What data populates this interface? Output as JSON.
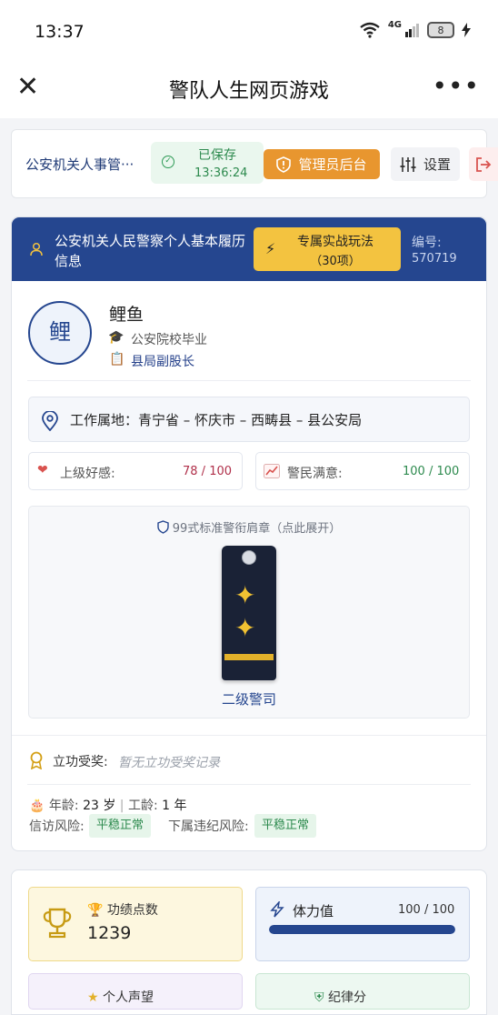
{
  "status_bar": {
    "time": "13:37",
    "network": "4G",
    "battery": "8"
  },
  "title_bar": {
    "title": "警队人生网页游戏"
  },
  "toolbar": {
    "dept_name": "公安机关人事管···",
    "saved_label": "已保存",
    "saved_time": "13:36:24",
    "admin_label": "管理员后台",
    "settings_label": "设置"
  },
  "profile": {
    "header_title": "公安机关人民警察个人基本履历信息",
    "special_line1": "专属实战玩法",
    "special_line2": "（30项）",
    "id_label": "编号:",
    "id_value": "570719",
    "avatar_char": "鲤",
    "name": "鲤鱼",
    "graduation": "公安院校毕业",
    "position": "县局副股长",
    "location": "工作属地：青宁省 – 怀庆市 – 西畴县 – 县公安局",
    "favor_label": "上级好感:",
    "favor_value": "78",
    "favor_max": "100",
    "satisfaction_label": "警民满意:",
    "satisfaction_value": "100",
    "satisfaction_max": "100",
    "badge_title": "99式标准警衔肩章（点此展开）",
    "rank": "二级警司",
    "merit_label": "立功受奖:",
    "merit_text": "暂无立功受奖记录",
    "age_label": "年龄:",
    "age_value": "23",
    "age_unit": "岁",
    "service_label": "工龄:",
    "service_value": "1",
    "service_unit": "年",
    "petition_label": "信访风险:",
    "petition_value": "平稳正常",
    "subordinate_label": "下属违纪风险:",
    "subordinate_value": "平稳正常"
  },
  "stats": {
    "merit_points_label": "功绩点数",
    "merit_points_value": "1239",
    "energy_label": "体力值",
    "energy_value": "100",
    "energy_max": "100",
    "energy_fraction": 1.0,
    "reputation_label": "个人声望",
    "discipline_label": "纪律分"
  },
  "colors": {
    "primary": "#25468f",
    "accent_orange": "#e8962f",
    "accent_yellow": "#f3c340",
    "success": "#2d8a4e",
    "danger": "#d9534f"
  }
}
